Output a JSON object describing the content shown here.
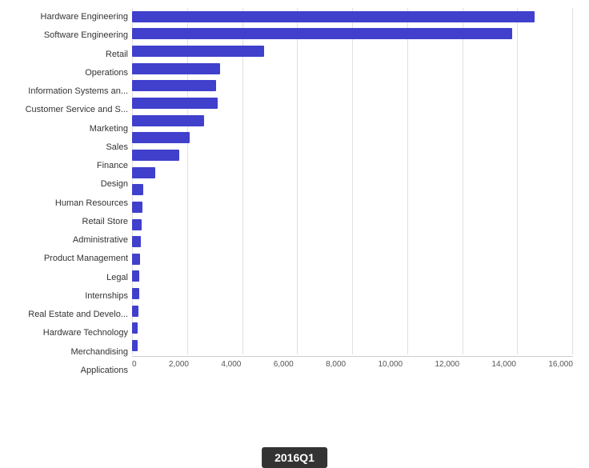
{
  "chart": {
    "title": "2016Q1",
    "maxValue": 16000,
    "xAxisLabels": [
      "0",
      "2,000",
      "4,000",
      "6,000",
      "8,000",
      "10,000",
      "12,000",
      "14,000",
      "16,000"
    ],
    "categories": [
      {
        "label": "Hardware Engineering",
        "value": 14600
      },
      {
        "label": "Software Engineering",
        "value": 13800
      },
      {
        "label": "Retail",
        "value": 4800
      },
      {
        "label": "Operations",
        "value": 3200
      },
      {
        "label": "Information Systems an...",
        "value": 3050
      },
      {
        "label": "Customer Service and S...",
        "value": 3100
      },
      {
        "label": "Marketing",
        "value": 2600
      },
      {
        "label": "Sales",
        "value": 2100
      },
      {
        "label": "Finance",
        "value": 1700
      },
      {
        "label": "Design",
        "value": 850
      },
      {
        "label": "Human Resources",
        "value": 420
      },
      {
        "label": "Retail Store",
        "value": 380
      },
      {
        "label": "Administrative",
        "value": 360
      },
      {
        "label": "Product Management",
        "value": 320
      },
      {
        "label": "Legal",
        "value": 290
      },
      {
        "label": "Internships",
        "value": 270
      },
      {
        "label": "Real Estate and Develo...",
        "value": 250
      },
      {
        "label": "Hardware Technology",
        "value": 230
      },
      {
        "label": "Merchandising",
        "value": 210
      },
      {
        "label": "Applications",
        "value": 200
      }
    ]
  }
}
